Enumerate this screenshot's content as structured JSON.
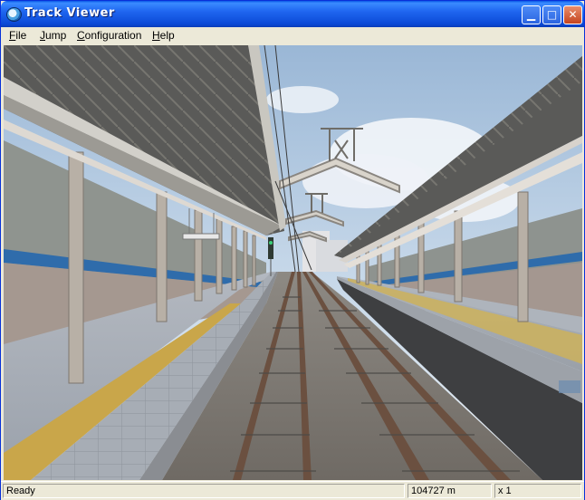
{
  "window": {
    "title": "Track Viewer"
  },
  "menu": {
    "items": [
      {
        "label": "File",
        "accel": "F",
        "rest": "ile"
      },
      {
        "label": "Jump",
        "accel": "J",
        "rest": "ump"
      },
      {
        "label": "Configuration",
        "accel": "C",
        "rest": "onfiguration"
      },
      {
        "label": "Help",
        "accel": "H",
        "rest": "elp"
      }
    ]
  },
  "titlebar_buttons": {
    "minimize": "▁",
    "maximize": "□",
    "close": "✕"
  },
  "status": {
    "text": "Ready",
    "distance": "104727 m",
    "speed": "x 1"
  },
  "scene": {
    "description_icon": "railway-station-view"
  }
}
